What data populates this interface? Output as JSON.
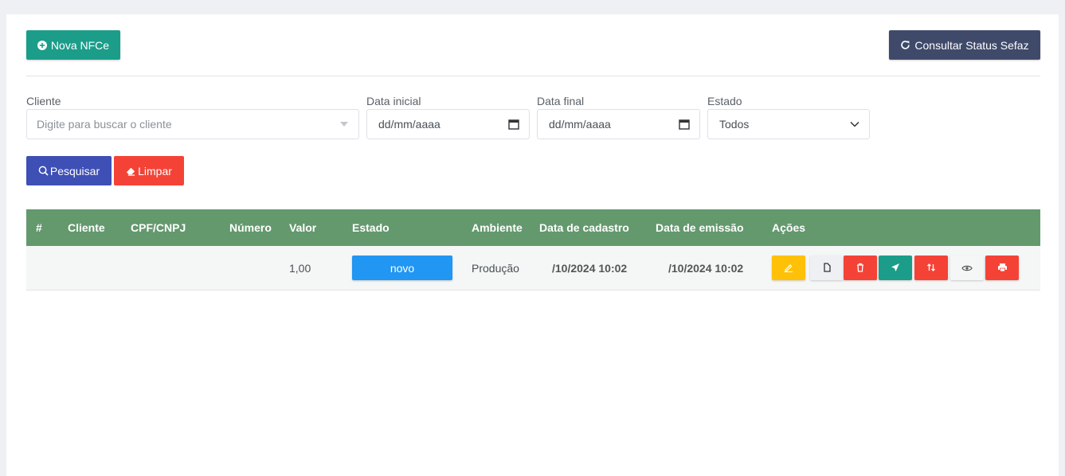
{
  "toolbar": {
    "nova_label": "Nova NFCe",
    "status_label": "Consultar Status Sefaz"
  },
  "filters": {
    "cliente_label": "Cliente",
    "cliente_placeholder": "Digite para buscar o cliente",
    "data_inicial_label": "Data inicial",
    "data_inicial_value": "dd/mm/aaaa",
    "data_final_label": "Data final",
    "data_final_value": "dd/mm/aaaa",
    "estado_label": "Estado",
    "estado_value": "Todos",
    "pesquisar_label": "Pesquisar",
    "limpar_label": "Limpar"
  },
  "table": {
    "headers": [
      "#",
      "Cliente",
      "CPF/CNPJ",
      "Número",
      "Valor",
      "Estado",
      "Ambiente",
      "Data de cadastro",
      "Data de emissão",
      "Ações"
    ],
    "rows": [
      {
        "id": "",
        "cliente": "",
        "cpf_cnpj": "",
        "numero": "",
        "valor": "1,00",
        "estado": "novo",
        "ambiente": "Produção",
        "data_cadastro": "/10/2024 10:02",
        "data_emissao": "/10/2024 10:02"
      }
    ]
  },
  "colors": {
    "primary_green": "#1b9d8a",
    "header_green": "#63996d",
    "dark_button": "#3f4a6b",
    "blue_button": "#3e4fb5",
    "red": "#f44336",
    "yellow": "#ffc107",
    "badge_blue": "#2196f3"
  },
  "icons": {
    "nova": "plus-circle-icon",
    "status": "refresh-icon",
    "pesquisar": "search-icon",
    "limpar": "eraser-icon",
    "actions": [
      "pencil-icon",
      "document-icon",
      "trash-icon",
      "send-icon",
      "transfer-icon",
      "eye-icon",
      "print-icon"
    ]
  }
}
